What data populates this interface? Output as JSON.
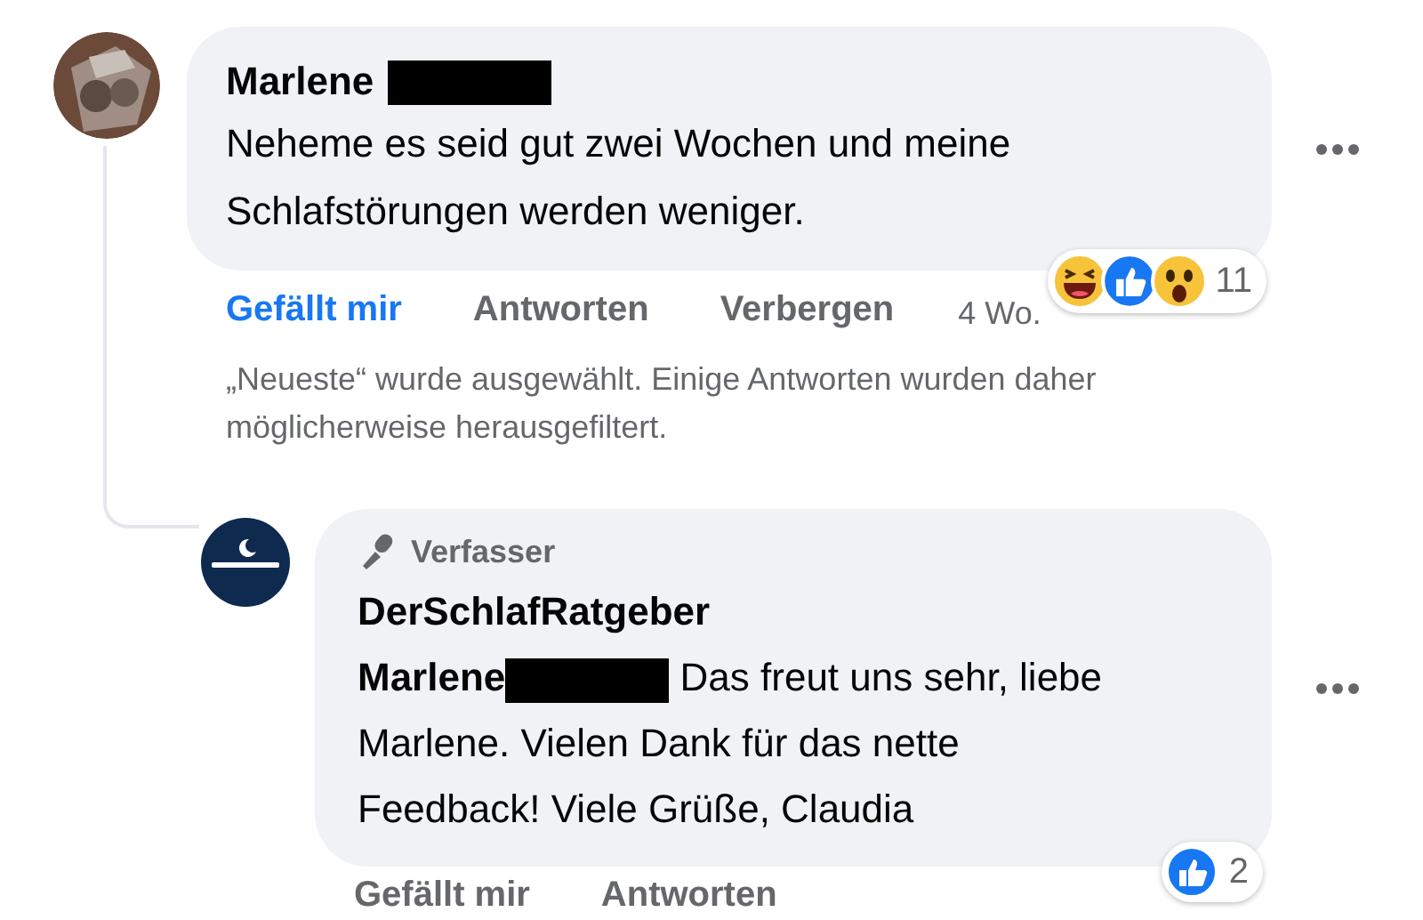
{
  "comment": {
    "author": "Marlene",
    "text": "Neheme es seid gut zwei Wochen und meine Schlafstörungen werden weniger.",
    "reactions": {
      "count": "11"
    },
    "actions": [
      {
        "label": "Gefällt mir",
        "selected": true
      },
      {
        "label": "Antworten",
        "selected": false
      },
      {
        "label": "Verbergen",
        "selected": false
      }
    ],
    "time": "4 Wo."
  },
  "filter_notice": "„Neueste“ wurde ausgewählt. Einige Antworten wurden daher möglicherweise herausgefiltert.",
  "reply": {
    "badge": "Verfasser",
    "author": "DerSchlafRatgeber",
    "mention": "Marlene",
    "text": "Das freut uns sehr, liebe Marlene. Vielen Dank für das nette Feedback! Viele Grüße, Claudia",
    "reactions": {
      "count": "2"
    },
    "actions": [
      {
        "label": "Gefällt mir",
        "selected": false
      },
      {
        "label": "Antworten",
        "selected": false
      }
    ]
  }
}
